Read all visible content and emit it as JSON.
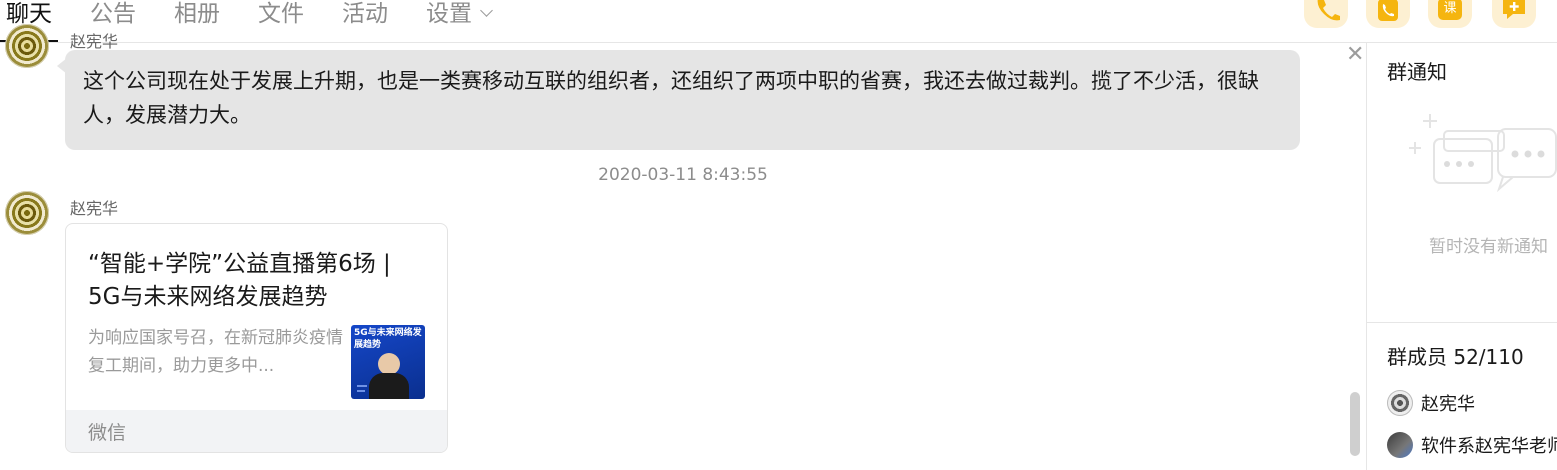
{
  "tabs": [
    {
      "label": "聊天",
      "active": true
    },
    {
      "label": "公告",
      "active": false
    },
    {
      "label": "相册",
      "active": false
    },
    {
      "label": "文件",
      "active": false
    },
    {
      "label": "活动",
      "active": false
    },
    {
      "label": "设置",
      "active": false
    }
  ],
  "toolbar": {
    "icons": [
      "phone-call-icon",
      "video-call-icon",
      "course-icon",
      "add-message-icon"
    ],
    "course_glyph": "课",
    "accent_color": "#f5b50f"
  },
  "chat": {
    "prev_sender_partial": "赵宪华",
    "message_text": "这个公司现在处于发展上升期，也是一类赛移动互联的组织者，还组织了两项中职的省赛，我还去做过裁判。揽了不少活，很缺人，发展潜力大。",
    "timestamp": "2020-03-11 8:43:55",
    "sender": "赵宪华",
    "card": {
      "title": "“智能+学院”公益直播第6场 | 5G与未来网络发展趋势",
      "description": "为响应国家号召，在新冠肺炎疫情复工期间，助力更多中...",
      "thumb_text": "5G与未来网络发展趋势",
      "source": "微信"
    }
  },
  "side": {
    "notice_title": "群通知",
    "notice_empty": "暂时没有新通知",
    "members_title": "群成员 52/110",
    "members": [
      {
        "name": "赵宪华"
      },
      {
        "name": "软件系赵宪华老师"
      }
    ]
  }
}
